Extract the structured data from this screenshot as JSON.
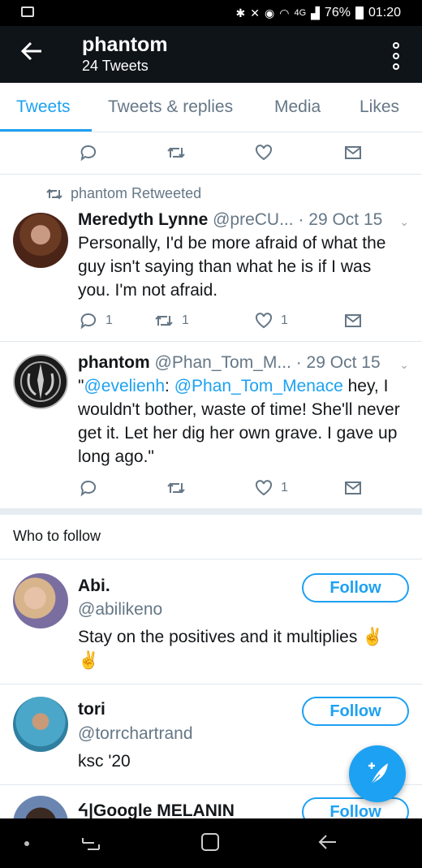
{
  "status_bar": {
    "battery": "76%",
    "time": "01:20",
    "network": "4G"
  },
  "header": {
    "title": "phantom",
    "subtitle": "24 Tweets"
  },
  "tabs": [
    {
      "label": "Tweets"
    },
    {
      "label": "Tweets & replies"
    },
    {
      "label": "Media"
    },
    {
      "label": "Likes"
    }
  ],
  "tweets": [
    {
      "retweet_label": "phantom Retweeted",
      "name": "Meredyth Lynne",
      "handle": "@preCU...",
      "date": "· 29 Oct 15",
      "text": "Personally, I'd be more afraid of what the guy isn't saying than what he is if I was you. I'm not afraid.",
      "replies": "1",
      "retweets": "1",
      "likes": "1"
    },
    {
      "name": "phantom",
      "handle": "@Phan_Tom_M...",
      "date": "· 29 Oct 15",
      "text_open": "\"",
      "mention1": "@evelienh",
      "text_colon": ": ",
      "mention2": "@Phan_Tom_Menace",
      "text_rest": " hey, I wouldn't bother, waste of time! She'll never get it. Let her dig her own grave. I gave up long ago.\"",
      "likes": "1"
    }
  ],
  "who_to_follow": {
    "title": "Who to follow",
    "follow_label": "Follow",
    "users": [
      {
        "name": "Abi.",
        "handle": "@abilikeno",
        "bio": "Stay on the positives and it multiplies ✌ ✌"
      },
      {
        "name": "tori",
        "handle": "@torrchartrand",
        "bio": "ksc '20"
      },
      {
        "name": "ᔦ|Google MELANIN"
      }
    ]
  },
  "colors": {
    "accent": "#1da1f2",
    "header_bg": "#0f1419",
    "muted": "#657786"
  }
}
